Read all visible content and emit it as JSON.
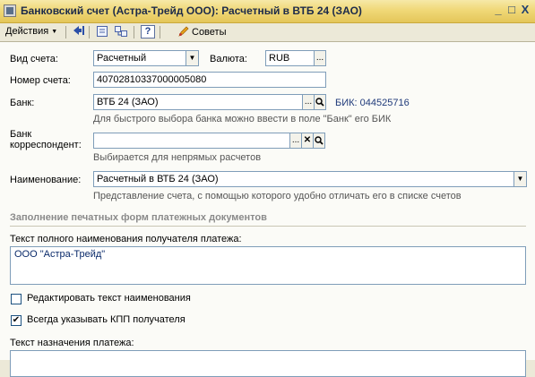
{
  "window": {
    "title": "Банковский счет (Астра-Трейд ООО): Расчетный в ВТБ 24 (ЗАО)",
    "minimize_glyph": "_",
    "maximize_glyph": "□",
    "close_glyph": "X"
  },
  "toolbar": {
    "actions_label": "Действия",
    "help_glyph": "?",
    "tips_label": "Советы"
  },
  "form": {
    "account_type_label": "Вид счета:",
    "account_type_value": "Расчетный",
    "currency_label": "Валюта:",
    "currency_value": "RUB",
    "account_number_label": "Номер счета:",
    "account_number_value": "40702810337000005080",
    "bank_label": "Банк:",
    "bank_value": "ВТБ 24 (ЗАО)",
    "bik_text": "БИК: 044525716",
    "bank_hint": "Для быстрого выбора банка можно ввести в поле \"Банк\" его БИК",
    "corr_bank_label_line1": "Банк",
    "corr_bank_label_line2": "корреспондент:",
    "corr_bank_value": "",
    "corr_bank_hint": "Выбирается для непрямых расчетов",
    "name_label": "Наименование:",
    "name_value": "Расчетный в ВТБ 24 (ЗАО)",
    "name_hint": "Представление счета, с помощью которого удобно отличать его в списке счетов",
    "ellipsis": "...",
    "search_glyph": "🔍",
    "clear_glyph": "✕",
    "dropdown_glyph": "▼"
  },
  "print_section": {
    "title": "Заполнение печатных форм платежных документов",
    "recipient_text_label": "Текст полного наименования получателя платежа:",
    "recipient_text_value": "ООО \"Астра-Трейд\"",
    "edit_name_checkbox_label": "Редактировать текст наименования",
    "edit_name_checked": false,
    "always_kpp_checkbox_label": "Всегда указывать КПП получателя",
    "always_kpp_checked": true,
    "payment_purpose_label": "Текст назначения платежа:",
    "check_glyph": "✔"
  }
}
